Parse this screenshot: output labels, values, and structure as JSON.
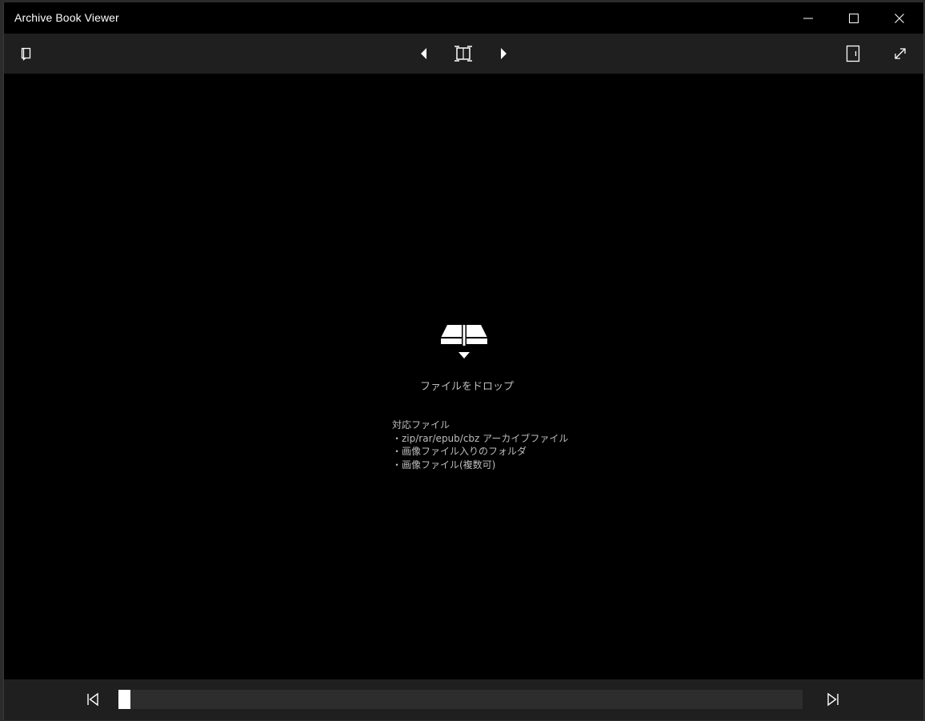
{
  "window": {
    "title": "Archive Book Viewer",
    "caption_buttons": [
      "minimize-icon",
      "maximize-icon",
      "close-icon"
    ]
  },
  "toolbar": {
    "left": [
      "book-spread-icon"
    ],
    "center": [
      "prev-page-icon",
      "fit-page-icon",
      "next-page-icon"
    ],
    "right": [
      "single-page-icon",
      "fullscreen-icon"
    ]
  },
  "viewer": {
    "drop_icon": "drop-book-icon",
    "drop_label": "ファイルをドロップ",
    "supported_title": "対応ファイル",
    "supported_items": [
      "・zip/rar/epub/cbz アーカイブファイル",
      "・画像ファイル入りのフォルダ",
      "・画像ファイル(複数可)"
    ]
  },
  "bottombar": {
    "first_icon": "first-page-icon",
    "last_icon": "last-page-icon",
    "slider_position": 0
  },
  "colors": {
    "background": "#000000",
    "bars": "#1f1f1f",
    "track": "#2d2d2d",
    "text_muted": "#bdbdbd"
  }
}
